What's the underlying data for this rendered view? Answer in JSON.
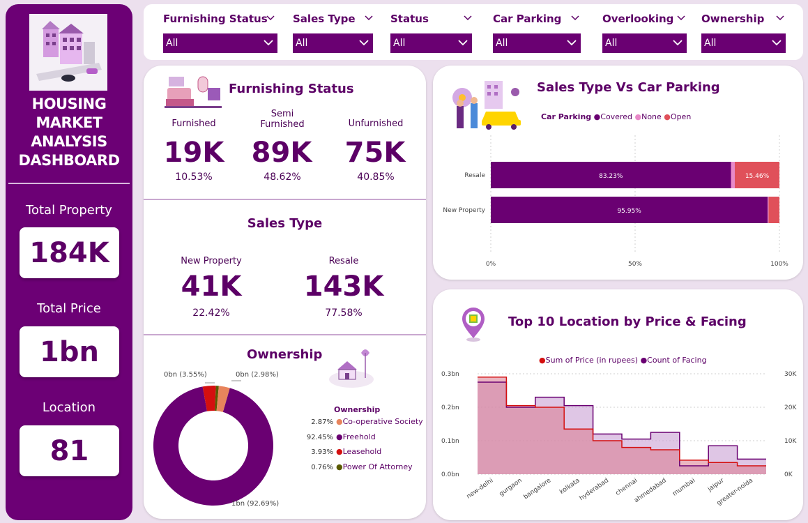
{
  "sidebar": {
    "title_lines": [
      "HOUSING",
      "MARKET",
      "ANALYSIS",
      "DASHBOARD"
    ],
    "kpis": [
      {
        "label": "Total Property",
        "value": "184K"
      },
      {
        "label": "Total Price",
        "value": "1bn"
      },
      {
        "label": "Location",
        "value": "81"
      }
    ]
  },
  "filters": [
    {
      "label": "Furnishing Status",
      "value": "All"
    },
    {
      "label": "Sales Type",
      "value": "All"
    },
    {
      "label": "Status",
      "value": "All"
    },
    {
      "label": "Car Parking",
      "value": "All"
    },
    {
      "label": "Overlooking",
      "value": "All"
    },
    {
      "label": "Ownership",
      "value": "All"
    }
  ],
  "furnishing": {
    "title": "Furnishing Status",
    "items": [
      {
        "label": "Furnished",
        "value": "19K",
        "pct": "10.53%"
      },
      {
        "label_line1": "Semi",
        "label_line2": "Furnished",
        "value": "89K",
        "pct": "48.62%"
      },
      {
        "label": "Unfurnished",
        "value": "75K",
        "pct": "40.85%"
      }
    ]
  },
  "sales_type": {
    "title": "Sales Type",
    "items": [
      {
        "label": "New Property",
        "value": "41K",
        "pct": "22.42%"
      },
      {
        "label": "Resale",
        "value": "143K",
        "pct": "77.58%"
      }
    ]
  },
  "ownership": {
    "title": "Ownership",
    "legend_title": "Ownership",
    "labels": {
      "top_left": "0bn (3.55%)",
      "top_right": "0bn (2.98%)",
      "bottom": "1bn (92.69%)"
    },
    "legend": [
      {
        "pct": "2.87%",
        "name": "Co-operative Society",
        "color": "#e8845c"
      },
      {
        "pct": "92.45%",
        "name": "Freehold",
        "color": "#6a0072"
      },
      {
        "pct": "3.93%",
        "name": "Leasehold",
        "color": "#d40f0f"
      },
      {
        "pct": "0.76%",
        "name": "Power Of Attorney",
        "color": "#5a5a00"
      }
    ]
  },
  "sales_parking": {
    "title": "Sales Type Vs Car Parking",
    "legend_title": "Car Parking",
    "legend": [
      {
        "name": "Covered",
        "color": "#6a0072"
      },
      {
        "name": "None",
        "color": "#e889c8"
      },
      {
        "name": "Open",
        "color": "#e0505a"
      }
    ],
    "x_ticks": [
      "0%",
      "50%",
      "100%"
    ]
  },
  "location": {
    "title": "Top 10 Location by Price & Facing",
    "legend": [
      {
        "name": "Sum of Price (in rupees)",
        "color": "#d40f0f"
      },
      {
        "name": "Count of Facing",
        "color": "#6a0072"
      }
    ],
    "y_left_ticks": [
      "0.3bn",
      "0.2bn",
      "0.1bn",
      "0.0bn"
    ],
    "y_right_ticks": [
      "30K",
      "20K",
      "10K",
      "0K"
    ]
  },
  "chart_data": [
    {
      "type": "bar",
      "title": "Sales Type Vs Car Parking",
      "orientation": "horizontal-stacked-100",
      "categories": [
        "Resale",
        "New Property"
      ],
      "series": [
        {
          "name": "Covered",
          "values": [
            83.23,
            95.95
          ],
          "labels": [
            "83.23%",
            "95.95%"
          ]
        },
        {
          "name": "None",
          "values": [
            1.31,
            0.3
          ],
          "labels": [
            "",
            ""
          ]
        },
        {
          "name": "Open",
          "values": [
            15.46,
            3.75
          ],
          "labels": [
            "15.46%",
            ""
          ]
        }
      ],
      "xlim": [
        0,
        100
      ]
    },
    {
      "type": "area",
      "title": "Top 10 Location by Price & Facing",
      "categories": [
        "new-delhi",
        "gurgaon",
        "bangalore",
        "kolkata",
        "hyderabad",
        "chennai",
        "ahmedabad",
        "mumbai",
        "jaipur",
        "greater-noida"
      ],
      "series": [
        {
          "name": "Sum of Price (in rupees)",
          "axis": "left",
          "values": [
            0.29,
            0.205,
            0.2,
            0.135,
            0.1,
            0.08,
            0.073,
            0.042,
            0.035,
            0.025
          ]
        },
        {
          "name": "Count of Facing",
          "axis": "right",
          "values": [
            27500,
            20000,
            23000,
            20500,
            12000,
            10500,
            12500,
            2500,
            8500,
            4500
          ]
        }
      ],
      "ylim_left": [
        0,
        0.3
      ],
      "ylim_right": [
        0,
        30000
      ]
    },
    {
      "type": "pie",
      "title": "Ownership",
      "labels": [
        "Freehold",
        "Leasehold",
        "Co-operative Society",
        "Power Of Attorney"
      ],
      "values": [
        92.69,
        3.55,
        2.98,
        0.78
      ]
    }
  ]
}
